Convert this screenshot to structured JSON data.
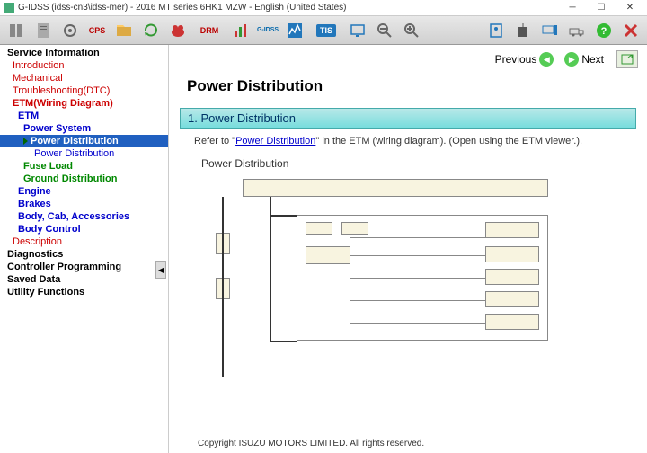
{
  "window": {
    "title": "G-IDSS (idss-cn3\\idss-mer) - 2016 MT series 6HK1 MZW - English (United States)"
  },
  "nav": {
    "prev": "Previous",
    "next": "Next"
  },
  "page": {
    "title": "Power Distribution",
    "section_number": "1. Power Distribution",
    "refer_pre": "Refer to \"",
    "refer_link": "Power Distribution",
    "refer_post": "\" in the ETM (wiring diagram). (Open using the ETM viewer.).",
    "subtitle": "Power Distribution",
    "copyright": "Copyright ISUZU MOTORS LIMITED. All rights reserved."
  },
  "tree": {
    "n0": "Service Information",
    "n1": "Introduction",
    "n2": "Mechanical",
    "n3": "Troubleshooting(DTC)",
    "n4": "ETM(Wiring Diagram)",
    "n5": "ETM",
    "n6": "Power System",
    "n7": "Power Distribution",
    "n8": "Power Distribution",
    "n9": "Fuse Load",
    "n10": "Ground Distribution",
    "n11": "Engine",
    "n12": "Brakes",
    "n13": "Body, Cab, Accessories",
    "n14": "Body Control",
    "n15": "Description",
    "n16": "Diagnostics",
    "n17": "Controller Programming",
    "n18": "Saved Data",
    "n19": "Utility Functions"
  },
  "toolbar": {
    "drm": "DRM",
    "gidss": "G-IDSS",
    "tis": "TIS",
    "cps": "CPS"
  }
}
